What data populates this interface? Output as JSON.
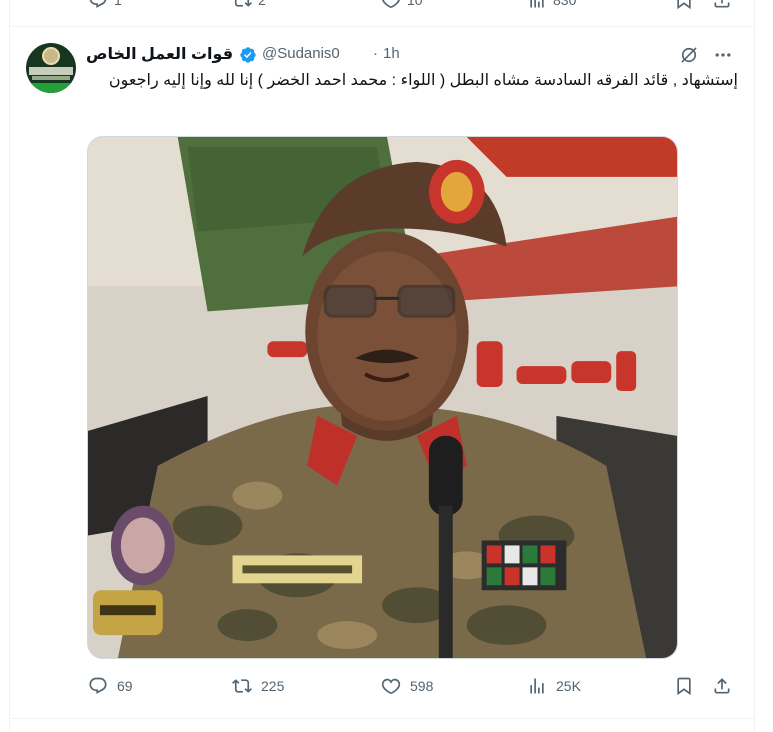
{
  "previous_tweet": {
    "reply_count": "1",
    "repost_count": "2",
    "like_count": "10",
    "view_count": "830"
  },
  "tweet": {
    "display_name": "قوات العمل الخاص",
    "verified": true,
    "handle": "@Sudanis0",
    "separator": "·",
    "time": "1h",
    "text": "إستشهاد , قائد الفرقه السادسة مشاه البطل   ( اللواء : محمد احمد الخضر ) إنا لله وإنا إليه راجعون",
    "actions": {
      "reply_count": "69",
      "repost_count": "225",
      "like_count": "598",
      "view_count": "25K"
    }
  },
  "colors": {
    "text_primary": "#0f1419",
    "text_secondary": "#536471",
    "verified_blue": "#1d9bf0",
    "border": "#eff3f4"
  },
  "icons": {
    "reply": "speech-bubble-icon",
    "repost": "repost-arrows-icon",
    "like": "heart-icon",
    "views": "bar-chart-icon",
    "bookmark": "bookmark-icon",
    "share": "share-upload-icon",
    "grok": "grok-slash-circle-icon",
    "more": "more-dots-icon"
  }
}
